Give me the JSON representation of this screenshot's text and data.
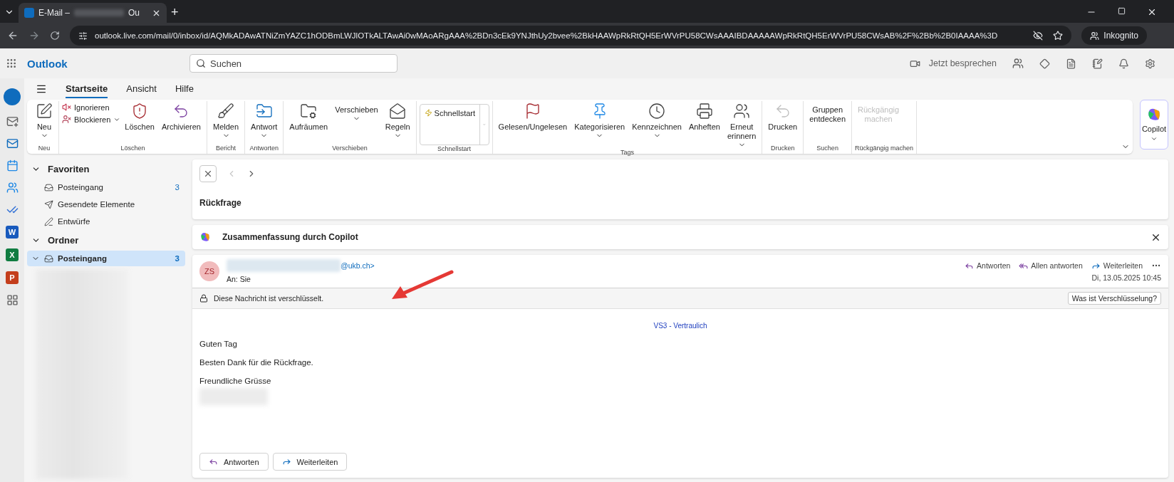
{
  "browser": {
    "tab_title": "E-Mail –",
    "tab_title_end": "Ou",
    "new_tab": "+",
    "url": "outlook.live.com/mail/0/inbox/id/AQMkADAwATNiZmYAZC1hODBmLWJlOTkALTAwAi0wMAoARgAAA%2BDn3cEk9YNJthUy2bvee%2BkHAAWpRkRtQH5ErWVrPU58CWsAAAIBDAAAAAWpRkRtQH5ErWVrPU58CWsAB%2F%2Bb%2B0IAAAA%3D",
    "profile": "Inkognito"
  },
  "app": {
    "name": "Outlook",
    "search": {
      "placeholder": "Suchen"
    },
    "meet_label": "Jetzt besprechen"
  },
  "rail": {
    "app_letters": [
      "W",
      "X",
      "P"
    ]
  },
  "ribbon": {
    "tabs": [
      {
        "label": "Startseite",
        "selected": true
      },
      {
        "label": "Ansicht",
        "selected": false
      },
      {
        "label": "Hilfe",
        "selected": false
      }
    ],
    "groups": [
      {
        "label": "Neu",
        "buttons": [
          {
            "kind": "large",
            "label": "Neu",
            "dropdown": true,
            "disabled": false
          }
        ]
      },
      {
        "label": "Löschen",
        "buttons": [
          {
            "kind": "small",
            "label": "Ignorieren",
            "dropdown": false,
            "disabled": false
          },
          {
            "kind": "small",
            "label": "Blockieren",
            "dropdown": true,
            "disabled": false
          },
          {
            "kind": "large",
            "label": "Löschen",
            "dropdown": false,
            "disabled": false
          },
          {
            "kind": "large",
            "label": "Archivieren",
            "dropdown": false,
            "disabled": false
          }
        ]
      },
      {
        "label": "Bericht",
        "buttons": [
          {
            "kind": "large",
            "label": "Melden",
            "dropdown": true,
            "disabled": false
          }
        ]
      },
      {
        "label": "Antworten",
        "buttons": [
          {
            "kind": "large",
            "label": "Antwort",
            "dropdown": true,
            "disabled": false
          }
        ]
      },
      {
        "label": "Verschieben",
        "buttons": [
          {
            "kind": "large",
            "label": "Aufräumen",
            "dropdown": false,
            "disabled": false
          },
          {
            "kind": "large",
            "label": "Verschieben",
            "dropdown": true,
            "disabled": false
          },
          {
            "kind": "large",
            "label": "Regeln",
            "dropdown": true,
            "disabled": false
          }
        ]
      },
      {
        "label": "Schnellstart",
        "buttons": [
          {
            "kind": "quickstep",
            "label": "Schnellstart",
            "dropdown": true,
            "disabled": false
          }
        ]
      },
      {
        "label": "Tags",
        "buttons": [
          {
            "kind": "large",
            "label": "Gelesen/Ungelesen",
            "dropdown": false,
            "disabled": false
          },
          {
            "kind": "large",
            "label": "Kategorisieren",
            "dropdown": true,
            "disabled": false
          },
          {
            "kind": "large",
            "label": "Kennzeichnen",
            "dropdown": true,
            "disabled": false
          },
          {
            "kind": "large",
            "label": "Anheften",
            "dropdown": false,
            "disabled": false
          },
          {
            "kind": "large",
            "label": "Erneut erinnern",
            "dropdown": true,
            "disabled": false
          }
        ]
      },
      {
        "label": "Drucken",
        "buttons": [
          {
            "kind": "large",
            "label": "Drucken",
            "dropdown": false,
            "disabled": false
          }
        ]
      },
      {
        "label": "Suchen",
        "buttons": [
          {
            "kind": "large",
            "label": "Gruppen entdecken",
            "dropdown": false,
            "disabled": false
          }
        ]
      },
      {
        "label": "Rückgängig machen",
        "buttons": [
          {
            "kind": "large",
            "label": "Rückgängig machen",
            "dropdown": false,
            "disabled": true
          }
        ]
      }
    ],
    "copilot": "Copilot"
  },
  "folders": [
    {
      "title": "Favoriten",
      "expanded": true,
      "items": [
        {
          "label": "Posteingang",
          "count": "3",
          "selected": false
        },
        {
          "label": "Gesendete Elemente",
          "selected": false
        },
        {
          "label": "Entwürfe",
          "selected": false
        }
      ]
    },
    {
      "title": "Ordner",
      "expanded": true,
      "items": [
        {
          "label": "Posteingang",
          "count": "3",
          "selected": true,
          "expanded": true
        }
      ]
    }
  ],
  "mail": {
    "subject": "Rückfrage",
    "copilot_summary": "Zusammenfassung durch Copilot",
    "avatar": "ZS",
    "sender": "@ukb.ch>",
    "to_label": "An:",
    "to": "Sie",
    "actions": [
      "Antworten",
      "Allen antworten",
      "Weiterleiten"
    ],
    "date": "Di, 13.05.2025 10:45",
    "notice": "Diese Nachricht ist verschlüsselt.",
    "notice_button": "Was ist Verschlüsselung?",
    "classification": "VS3 - Vertraulich",
    "body": [
      "Guten Tag",
      "Besten Dank für die Rückfrage.",
      "Freundliche Grüsse"
    ],
    "footer_buttons": [
      "Antworten",
      "Weiterleiten"
    ]
  }
}
